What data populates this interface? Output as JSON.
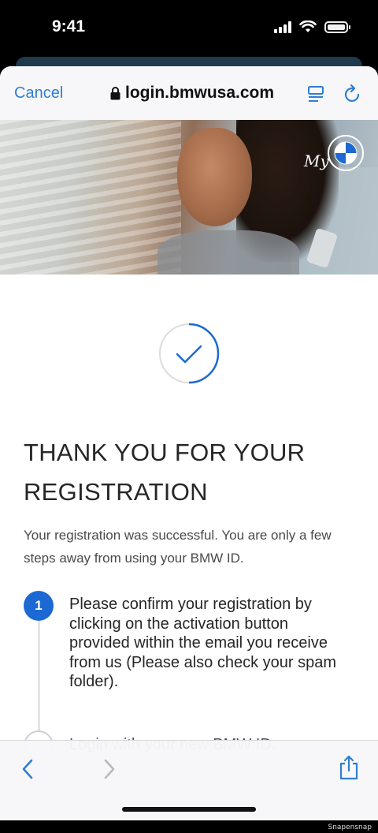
{
  "status_bar": {
    "time": "9:41"
  },
  "browser": {
    "cancel_label": "Cancel",
    "url": "login.bmwusa.com"
  },
  "hero": {
    "brand_script": "My"
  },
  "content": {
    "title": "THANK YOU FOR YOUR REGISTRATION",
    "description": "Your registration was successful. You are only a few steps away from using your BMW ID.",
    "steps": [
      {
        "number": "1",
        "text": "Please confirm your registration by clicking on the activation button provided within the email you receive from us (Please also check your spam folder)."
      },
      {
        "number": "",
        "text": "Login with your new BMW ID."
      }
    ]
  },
  "colors": {
    "accent": "#1c69d4",
    "link": "#2f7fd1"
  },
  "watermark": "Snapensnap"
}
